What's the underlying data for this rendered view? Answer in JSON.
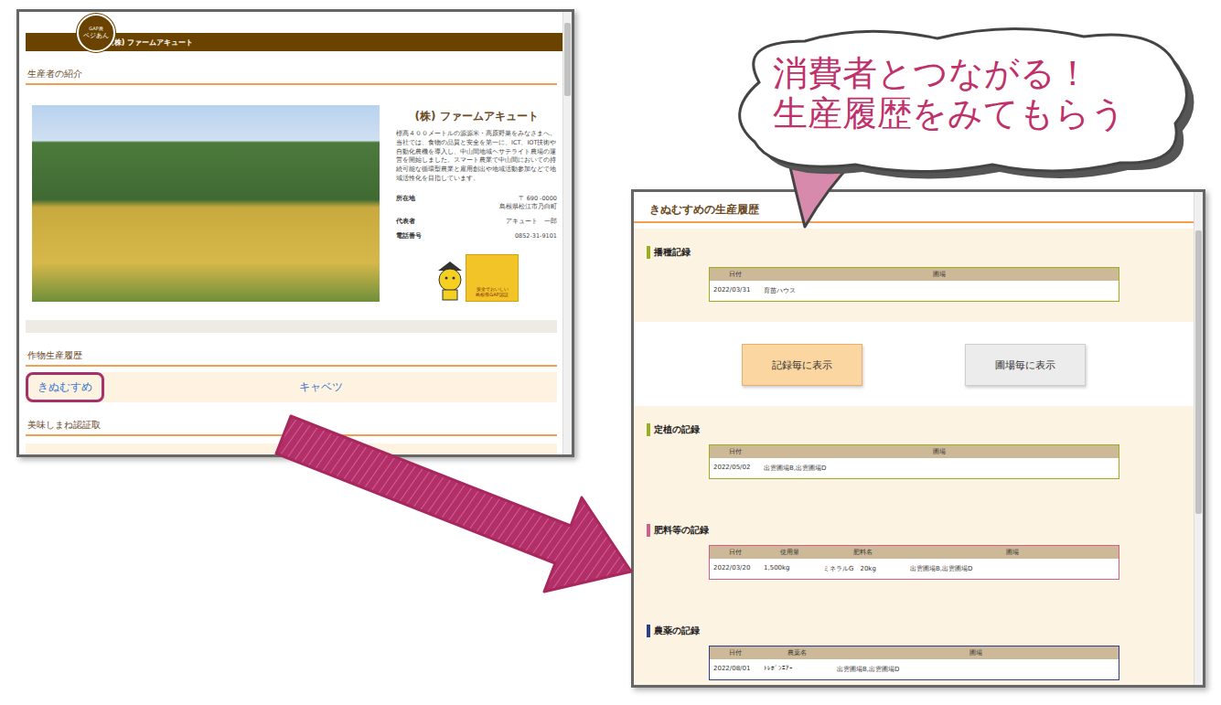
{
  "producer_page": {
    "logo": {
      "top": "GAP農",
      "name": "ベジあん"
    },
    "header_title": "(株) ファームアキュート",
    "intro_section": "生産者の紹介",
    "company": {
      "name": "(株) ファームアキュート",
      "description": "標高４００メートルの源源米・高原野菜をみなさまへ。当社では、食物の品質と安全を第一に、ICT、IOT技術や自動化農機を導入し、中山間地域ヘサテライト農場の運営を開始しました。スマート農業で中山間においての持続可能な循環型農業と雇用創出や地域活動参加などで地域活性化を目指しています。",
      "fields": [
        {
          "label": "所在地",
          "value": [
            "〒 690 -0000",
            "島根県松江市乃白町"
          ]
        },
        {
          "label": "代表者",
          "value": [
            "アキュート　一郎"
          ]
        },
        {
          "label": "電話番号",
          "value": [
            "0852-31-9101"
          ]
        }
      ],
      "badge": {
        "lines": [
          "安全でおいしい",
          "島根県GAP認証"
        ]
      }
    },
    "crops_section": "作物生産履歴",
    "crops": [
      {
        "label": "きぬむすめ",
        "selected": true
      },
      {
        "label": "キャベツ",
        "selected": false
      }
    ],
    "next_section": "美味しまね認証取"
  },
  "callout": {
    "lines": [
      "消費者とつながる！",
      "生産履歴をみてもらう"
    ]
  },
  "history_page": {
    "title": "きぬむすめの生産履歴",
    "view_buttons": [
      {
        "label": "記録毎に表示",
        "selected": true
      },
      {
        "label": "圃場毎に表示",
        "selected": false
      }
    ],
    "sections": [
      {
        "heading": "播種記録",
        "color": "#9aae1e",
        "columns": [
          "日付",
          "圃場"
        ],
        "rows": [
          [
            "2022/03/31",
            "育苗ハウス"
          ]
        ]
      },
      {
        "heading": "定植の記録",
        "color": "#9aae1e",
        "columns": [
          "日付",
          "圃場"
        ],
        "rows": [
          [
            "2022/05/02",
            "出雲圃場B,出雲圃場D"
          ]
        ]
      },
      {
        "heading": "肥料等の記録",
        "color": "#d0608a",
        "columns": [
          "日付",
          "使用量",
          "肥料名",
          "圃場"
        ],
        "rows": [
          [
            "2022/03/20",
            "1,500kg",
            "ミネラルG　20kg",
            "出雲圃場B,出雲圃場D"
          ]
        ]
      },
      {
        "heading": "農薬の記録",
        "color": "#2b3f8c",
        "columns": [
          "日付",
          "農薬名",
          "圃場"
        ],
        "rows": [
          [
            "2022/08/01",
            "ﾄﾚﾎﾞﾝｴｱｰ",
            "出雲圃場B,出雲圃場D"
          ]
        ]
      }
    ]
  }
}
